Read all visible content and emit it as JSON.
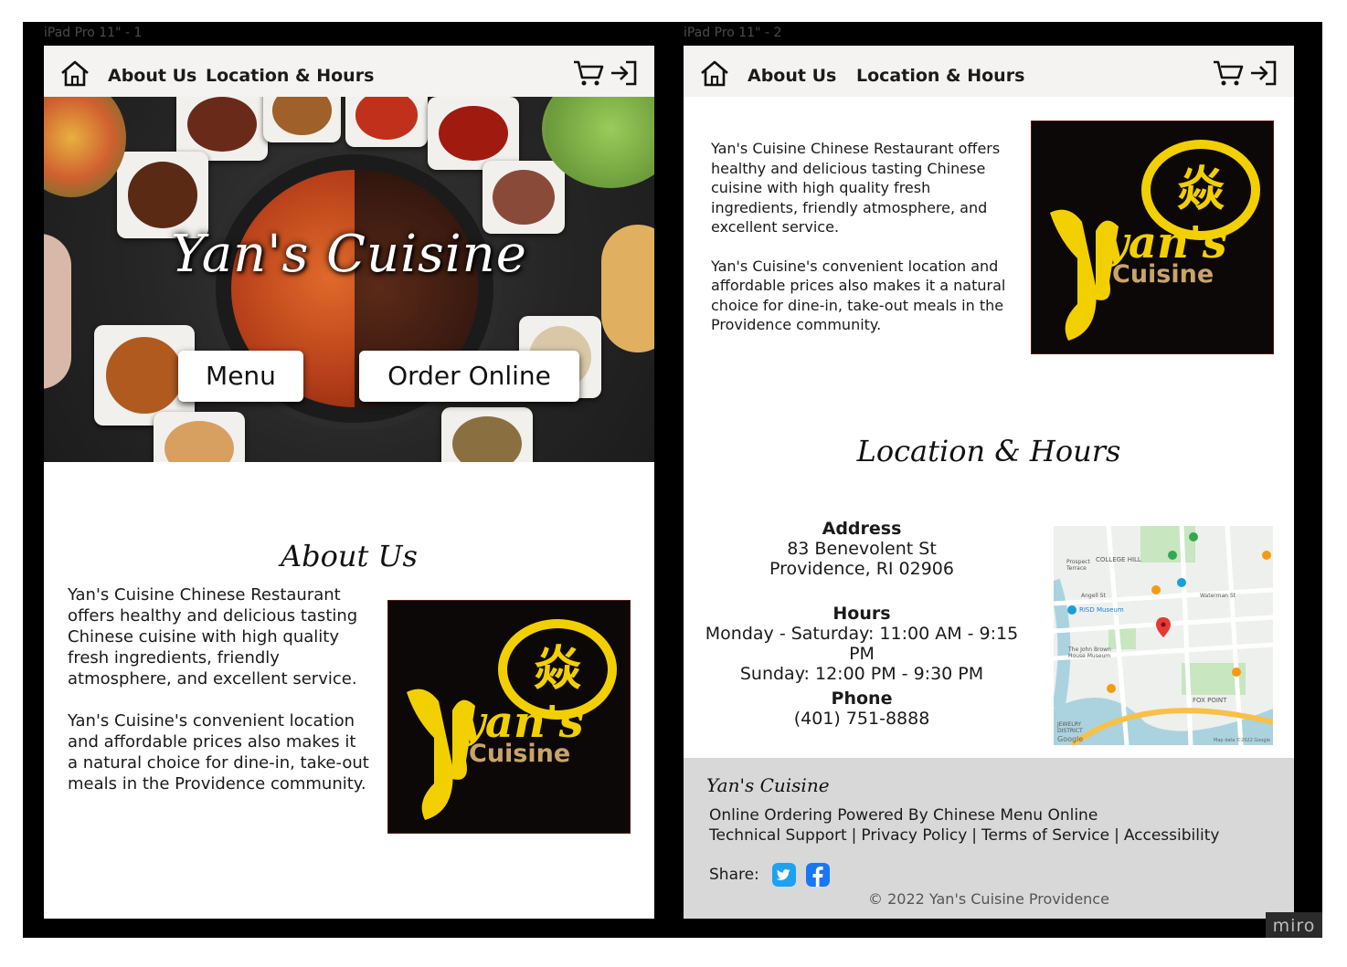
{
  "frames": {
    "frame1_label": "iPad Pro 11\" - 1",
    "frame2_label": "iPad Pro 11\" - 2",
    "watermark": "miro"
  },
  "nav": {
    "home_icon": "home-icon",
    "about": "About Us",
    "location": "Location & Hours",
    "cart_icon": "cart-icon",
    "login_icon": "login-icon"
  },
  "hero": {
    "title": "Yan's Cuisine",
    "menu_button": "Menu",
    "order_button": "Order Online"
  },
  "about": {
    "heading": "About Us",
    "p1": "Yan's Cuisine Chinese Restaurant offers healthy and delicious tasting Chinese cuisine with high quality fresh ingredients, friendly atmosphere, and excellent service.",
    "p2": "Yan's Cuisine's convenient location and affordable prices also makes it a natural choice for dine-in, take-out meals in the Providence community."
  },
  "logo": {
    "cuisine_text": "Cuisine",
    "script_text": "yan's",
    "colors": {
      "bg": "#0d0808",
      "gold": "#f2d000",
      "tan": "#c9a46a"
    }
  },
  "location": {
    "heading": "Location & Hours",
    "address_label": "Address",
    "address_line1": "83 Benevolent St",
    "address_line2": "Providence, RI 02906",
    "hours_label": "Hours",
    "hours_line1": "Monday - Saturday: 11:00 AM - 9:15 PM",
    "hours_line2": "Sunday: 12:00 PM - 9:30 PM",
    "phone_label": "Phone",
    "phone": "(401) 751-8888"
  },
  "map": {
    "labels": {
      "college_hill": "COLLEGE HILL",
      "prospect": "Prospect Terrace",
      "risd": "RISD Museum",
      "fox_point": "FOX POINT",
      "jewelry": "JEWELRY DISTRICT",
      "google": "Google",
      "map_credit": "Map data ©2022 Google",
      "waterman": "Waterman St",
      "angell": "Angell St",
      "brown": "The John Brown House Museum"
    }
  },
  "footer": {
    "brand": "Yan's Cuisine",
    "powered": "Online Ordering Powered By Chinese Menu Online",
    "links": [
      "Technical Support",
      "Privacy Policy",
      "Terms of Service",
      "Accessibility"
    ],
    "share_label": "Share:",
    "copyright": "© 2022 Yan's Cuisine Providence",
    "colors": {
      "twitter": "#1da1f2",
      "facebook": "#1877f2"
    }
  }
}
